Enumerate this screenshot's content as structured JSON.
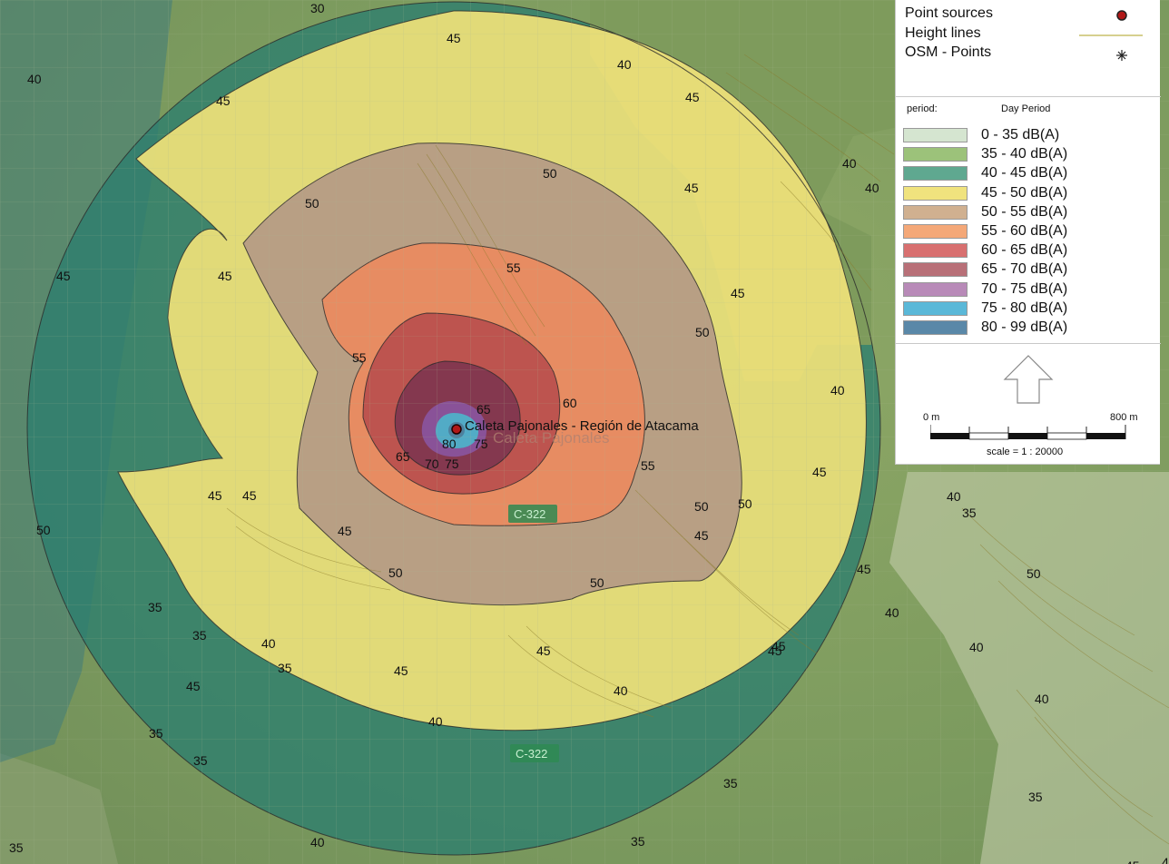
{
  "place": {
    "name": "Caleta Pajonales - Región de Atacama",
    "osm_label": "Caleta Pajonales"
  },
  "road_badges": [
    "C-322",
    "C-322"
  ],
  "contour_labels": [
    "30",
    "45",
    "40",
    "45",
    "50",
    "50",
    "45",
    "45",
    "45",
    "45",
    "40",
    "40",
    "40",
    "50",
    "45",
    "55",
    "50",
    "45",
    "55",
    "60",
    "65",
    "65",
    "70",
    "75",
    "80",
    "75",
    "55",
    "45",
    "45",
    "45",
    "40",
    "50",
    "50",
    "50",
    "50",
    "45",
    "45",
    "45",
    "40",
    "35",
    "35",
    "40",
    "35",
    "45",
    "40",
    "45",
    "45",
    "40",
    "40",
    "40",
    "35",
    "35",
    "35",
    "40",
    "35",
    "35",
    "35",
    "40",
    "35",
    "45",
    "50",
    "45",
    "40"
  ],
  "legend": {
    "symbols": [
      {
        "label": "Point sources",
        "icon": "point-source-icon"
      },
      {
        "label": "Height lines",
        "icon": "height-line-icon"
      },
      {
        "label": "OSM - Points",
        "icon": "asterisk-icon"
      }
    ],
    "period_label": "period:",
    "period_value": "Day Period",
    "bands": [
      {
        "label": "0 - 35 dB(A)",
        "color": "#d5e5d0"
      },
      {
        "label": "35 - 40 dB(A)",
        "color": "#9cc27a"
      },
      {
        "label": "40 - 45 dB(A)",
        "color": "#5fa890"
      },
      {
        "label": "45 - 50 dB(A)",
        "color": "#f0e37e"
      },
      {
        "label": "50 - 55 dB(A)",
        "color": "#d0b090"
      },
      {
        "label": "55 - 60 dB(A)",
        "color": "#f4a878"
      },
      {
        "label": "60 - 65 dB(A)",
        "color": "#d87070"
      },
      {
        "label": "65 - 70 dB(A)",
        "color": "#b87078"
      },
      {
        "label": "70 - 75 dB(A)",
        "color": "#b88ab8"
      },
      {
        "label": "75 - 80 dB(A)",
        "color": "#5ab8d8"
      },
      {
        "label": "80 - 99 dB(A)",
        "color": "#5a88a8"
      }
    ],
    "scale": {
      "start_label": "0 m",
      "end_label": "800 m",
      "ratio_label": "scale = 1 : 20000"
    }
  }
}
